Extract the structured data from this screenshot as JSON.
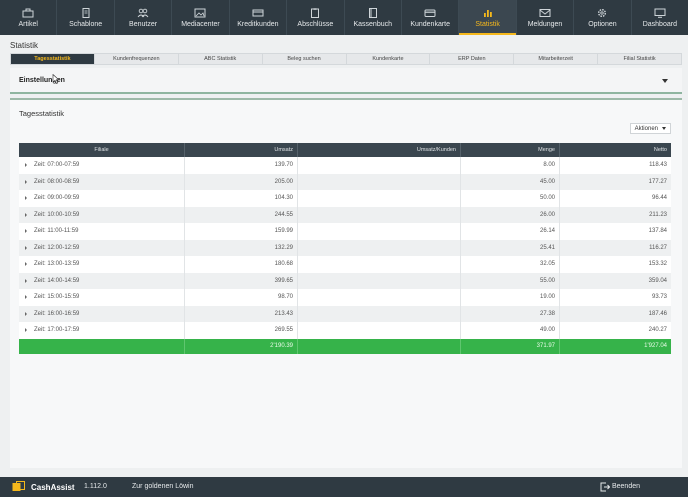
{
  "nav": {
    "items": [
      {
        "label": "Artikel",
        "icon": "briefcase-icon"
      },
      {
        "label": "Schablone",
        "icon": "document-icon"
      },
      {
        "label": "Benutzer",
        "icon": "users-icon"
      },
      {
        "label": "Mediacenter",
        "icon": "image-icon"
      },
      {
        "label": "Kreditkunden",
        "icon": "cards-icon"
      },
      {
        "label": "Abschlüsse",
        "icon": "clipboard-icon"
      },
      {
        "label": "Kassenbuch",
        "icon": "book-icon"
      },
      {
        "label": "Kundenkarte",
        "icon": "card-icon"
      },
      {
        "label": "Statistik",
        "icon": "bar-chart-icon"
      },
      {
        "label": "Meldungen",
        "icon": "envelope-icon"
      },
      {
        "label": "Optionen",
        "icon": "gear-icon"
      },
      {
        "label": "Dashboard",
        "icon": "monitor-icon"
      }
    ],
    "active": "Statistik",
    "accent": "#f5b81c"
  },
  "page": {
    "title": "Statistik"
  },
  "tabs": {
    "items": [
      "Tagesstatistik",
      "Kundenfrequenzen",
      "ABC Statistik",
      "Beleg suchen",
      "Kundenkarte",
      "ERP Daten",
      "Mitarbeiterzeit",
      "Filial Statistik"
    ],
    "active": "Tagesstatistik"
  },
  "settings": {
    "label": "Einstellungen"
  },
  "card": {
    "title": "Tagesstatistik",
    "actions_label": "Aktionen"
  },
  "table": {
    "headers": [
      "Filiale",
      "Umsatz",
      "Umsatz/Kunden",
      "Menge",
      "Netto"
    ],
    "rows": [
      {
        "filiale": "Zeit: 07:00-07:59",
        "umsatz": "139.70",
        "umsatz_kunden": "",
        "menge": "8.00",
        "netto": "118.43"
      },
      {
        "filiale": "Zeit: 08:00-08:59",
        "umsatz": "205.00",
        "umsatz_kunden": "",
        "menge": "45.00",
        "netto": "177.27"
      },
      {
        "filiale": "Zeit: 09:00-09:59",
        "umsatz": "104.30",
        "umsatz_kunden": "",
        "menge": "50.00",
        "netto": "96.44"
      },
      {
        "filiale": "Zeit: 10:00-10:59",
        "umsatz": "244.55",
        "umsatz_kunden": "",
        "menge": "26.00",
        "netto": "211.23"
      },
      {
        "filiale": "Zeit: 11:00-11:59",
        "umsatz": "159.99",
        "umsatz_kunden": "",
        "menge": "26.14",
        "netto": "137.84"
      },
      {
        "filiale": "Zeit: 12:00-12:59",
        "umsatz": "132.29",
        "umsatz_kunden": "",
        "menge": "25.41",
        "netto": "116.27"
      },
      {
        "filiale": "Zeit: 13:00-13:59",
        "umsatz": "180.68",
        "umsatz_kunden": "",
        "menge": "32.05",
        "netto": "153.32"
      },
      {
        "filiale": "Zeit: 14:00-14:59",
        "umsatz": "399.65",
        "umsatz_kunden": "",
        "menge": "55.00",
        "netto": "359.04"
      },
      {
        "filiale": "Zeit: 15:00-15:59",
        "umsatz": "98.70",
        "umsatz_kunden": "",
        "menge": "19.00",
        "netto": "93.73"
      },
      {
        "filiale": "Zeit: 16:00-16:59",
        "umsatz": "213.43",
        "umsatz_kunden": "",
        "menge": "27.38",
        "netto": "187.46"
      },
      {
        "filiale": "Zeit: 17:00-17:59",
        "umsatz": "269.55",
        "umsatz_kunden": "",
        "menge": "49.00",
        "netto": "240.27"
      }
    ],
    "total": {
      "filiale": "",
      "umsatz": "2'190.39",
      "umsatz_kunden": "",
      "menge": "371.97",
      "netto": "1'927.04"
    },
    "total_color": "#36b34a"
  },
  "footer": {
    "brand": "CashAssist",
    "version": "1.112.0",
    "branch": "Zur goldenen Löwin",
    "exit_label": "Beenden",
    "logo_color": "#f5b81c"
  }
}
